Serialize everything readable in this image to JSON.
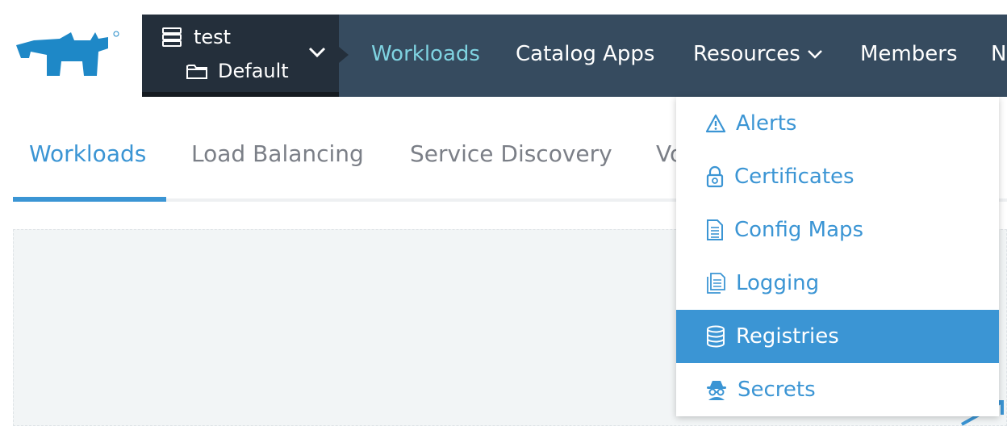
{
  "cluster": {
    "name": "test",
    "project": "Default"
  },
  "nav": {
    "items": [
      {
        "label": "Workloads"
      },
      {
        "label": "Catalog Apps"
      },
      {
        "label": "Resources"
      },
      {
        "label": "Members"
      },
      {
        "label": "N"
      }
    ]
  },
  "subtabs": {
    "items": [
      {
        "label": "Workloads"
      },
      {
        "label": "Load Balancing"
      },
      {
        "label": "Service Discovery"
      },
      {
        "label": "Vo"
      }
    ]
  },
  "resources_menu": {
    "items": [
      {
        "label": "Alerts",
        "icon": "warning-icon"
      },
      {
        "label": "Certificates",
        "icon": "lock-icon"
      },
      {
        "label": "Config Maps",
        "icon": "file-icon"
      },
      {
        "label": "Logging",
        "icon": "files-icon"
      },
      {
        "label": "Registries",
        "icon": "database-icon"
      },
      {
        "label": "Secrets",
        "icon": "spy-icon"
      }
    ],
    "selected": "Registries"
  },
  "colors": {
    "accent": "#3b95d4",
    "nav_bg": "#364b5f",
    "cluster_bg": "#242f3b",
    "nav_active": "#7fd3e1",
    "logo": "#1e88c7"
  }
}
